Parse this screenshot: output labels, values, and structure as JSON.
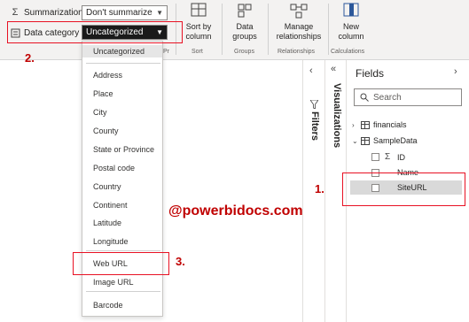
{
  "ribbon": {
    "summarization_label": "Summarization",
    "summarization_value": "Don't summarize",
    "data_category_label": "Data category",
    "data_category_value": "Uncategorized",
    "properties_group_fragment": "Pr",
    "sort_button": "Sort by column",
    "sort_group": "Sort",
    "groups_button": "Data groups",
    "groups_group": "Groups",
    "relationships_button": "Manage relationships",
    "relationships_group": "Relationships",
    "newcol_button": "New column",
    "calculations_group": "Calculations"
  },
  "dropdown": {
    "selected": "Uncategorized",
    "items": [
      "Address",
      "Place",
      "City",
      "County",
      "State or Province",
      "Postal code",
      "Country",
      "Continent",
      "Latitude",
      "Longitude",
      "Web URL",
      "Image URL",
      "Barcode"
    ]
  },
  "watermark": "@powerbidocs.com",
  "steps": [
    "1.",
    "2.",
    "3."
  ],
  "panes": {
    "filters": "Filters",
    "visualizations": "Visualizations",
    "fields_title": "Fields",
    "search_placeholder": "Search"
  },
  "fields": {
    "tables": [
      {
        "name": "financials",
        "expanded": false
      },
      {
        "name": "SampleData",
        "expanded": true,
        "columns": [
          {
            "name": "ID",
            "sigma": true
          },
          {
            "name": "Name",
            "sigma": false
          },
          {
            "name": "SiteURL",
            "sigma": false,
            "selected": true
          }
        ]
      }
    ]
  },
  "colors": {
    "annotation_red": "#e81123",
    "ribbon_bg": "#f3f2f1",
    "selected_row": "#d9d9d9"
  }
}
